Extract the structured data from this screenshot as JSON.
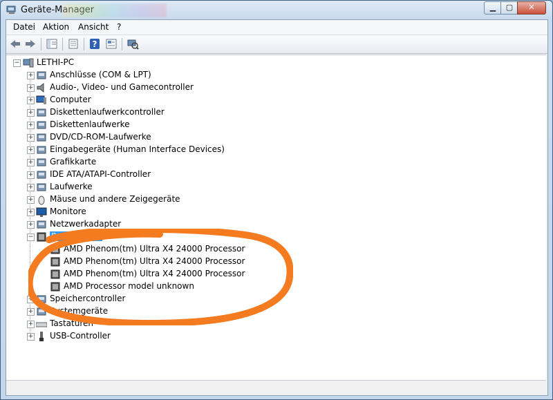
{
  "window": {
    "title": "Geräte-Manager"
  },
  "menubar": {
    "items": [
      "Datei",
      "Aktion",
      "Ansicht",
      "?"
    ]
  },
  "toolbar": {
    "icons": [
      "back-icon",
      "forward-icon",
      "tree-view-icon",
      "properties-icon",
      "help-icon",
      "show-hidden-icon",
      "scan-hardware-icon"
    ]
  },
  "tree": {
    "root": "LETHI-PC",
    "categories": [
      "Anschlüsse (COM & LPT)",
      "Audio-, Video- und Gamecontroller",
      "Computer",
      "Diskettenlaufwerkcontroller",
      "Diskettenlaufwerke",
      "DVD/CD-ROM-Laufwerke",
      "Eingabegeräte (Human Interface Devices)",
      "Grafikkarte",
      "IDE ATA/ATAPI-Controller",
      "Laufwerke",
      "Mäuse und andere Zeigegeräte",
      "Monitore",
      "Netzwerkadapter",
      "Prozessoren",
      "Speichercontroller",
      "Systemgeräte",
      "Tastaturen",
      "USB-Controller"
    ],
    "processors": [
      "AMD Phenom(tm) Ultra X4 24000 Processor",
      "AMD Phenom(tm) Ultra X4 24000 Processor",
      "AMD Phenom(tm) Ultra X4 24000 Processor",
      "AMD Processor model unknown"
    ]
  },
  "colors": {
    "annotation": "#f47b20",
    "selection": "#3399ff"
  }
}
